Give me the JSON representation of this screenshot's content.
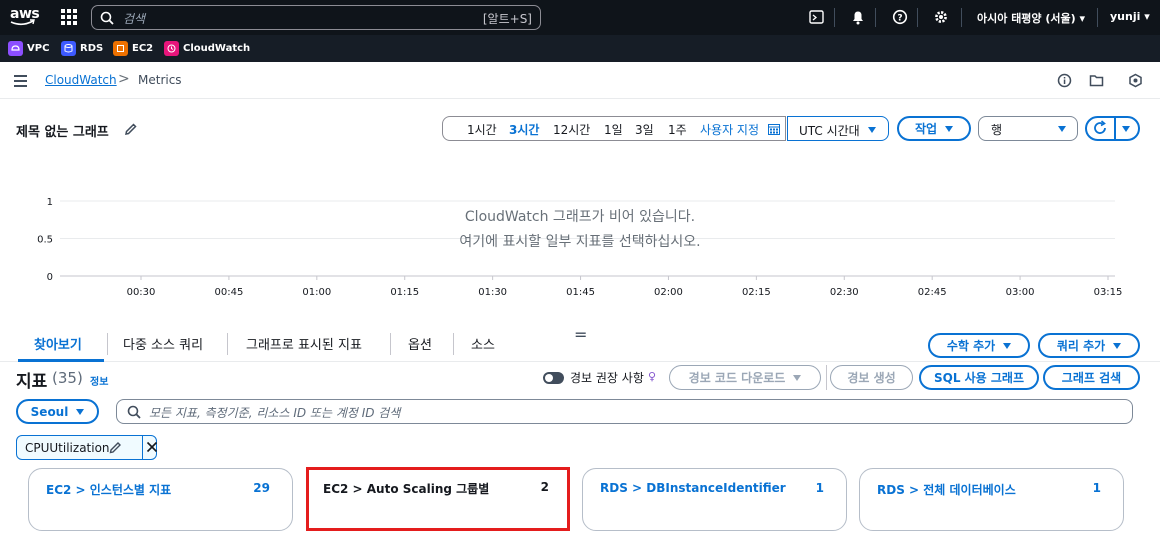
{
  "topnav": {
    "logo": "aws",
    "search_placeholder": "검색",
    "search_shortcut": "[알트+S]",
    "region": "아시아 태평양 (서울) ▾",
    "user": "yunji ▾",
    "icons": [
      "cloudshell-icon",
      "bell-icon",
      "help-icon",
      "settings-icon"
    ]
  },
  "favorites": [
    {
      "label": "VPC",
      "color": "#8c4fff"
    },
    {
      "label": "RDS",
      "color": "#3d5afe"
    },
    {
      "label": "EC2",
      "color": "#ed7100"
    },
    {
      "label": "CloudWatch",
      "color": "#e7157b"
    }
  ],
  "breadcrumb": {
    "parent": "CloudWatch",
    "separator": ">",
    "current": "Metrics"
  },
  "graph": {
    "title": "제목 없는 그래프",
    "time_ranges": [
      "1시간",
      "3시간",
      "12시간",
      "1일",
      "3일",
      "1주"
    ],
    "time_active": "3시간",
    "custom_range": "사용자 지정",
    "timezone": "UTC 시간대",
    "actions": "작업",
    "view_select": "행"
  },
  "chart_data": {
    "type": "line",
    "title": "",
    "empty_message_1": "CloudWatch 그래프가 비어 있습니다.",
    "empty_message_2": "여기에 표시할 일부 지표를 선택하십시오.",
    "x_ticks": [
      "00:30",
      "00:45",
      "01:00",
      "01:15",
      "01:30",
      "01:45",
      "02:00",
      "02:15",
      "02:30",
      "02:45",
      "03:00",
      "03:15"
    ],
    "y_ticks": [
      "1",
      "0.5",
      "0"
    ],
    "ylim": [
      0,
      1
    ],
    "series": []
  },
  "tabs": {
    "items": [
      "찾아보기",
      "다중 소스 쿼리",
      "그래프로 표시된 지표",
      "옵션",
      "소스"
    ],
    "active": "찾아보기",
    "handle": "="
  },
  "metrics": {
    "title": "지표",
    "count": "(35)",
    "info": "정보",
    "toggle_label": "경보 권장 사항",
    "bulb": "♀",
    "add_math": "수학 추가",
    "add_query": "쿼리 추가",
    "download_alarm_code": "경보 코드 다운로드",
    "create_alarm": "경보 생성",
    "sql_graph": "SQL 사용 그래프",
    "graph_search": "그래프 검색",
    "region_filter": "Seoul",
    "search_placeholder": "모든 지표, 측정기준, 리소스 ID 또는 계정 ID 검색",
    "token": "CPUUtilization"
  },
  "cards": [
    {
      "label": "EC2 > 인스턴스별 지표",
      "count": "29"
    },
    {
      "label": "EC2 > Auto Scaling 그룹별",
      "count": "2"
    },
    {
      "label": "RDS > DBInstanceIdentifier",
      "count": "1"
    },
    {
      "label": "RDS > 전체 데이터베이스",
      "count": "1"
    }
  ],
  "colors": {
    "accent": "#0972d3",
    "nav_bg": "#0f141a",
    "highlight": "#e41d1d"
  }
}
